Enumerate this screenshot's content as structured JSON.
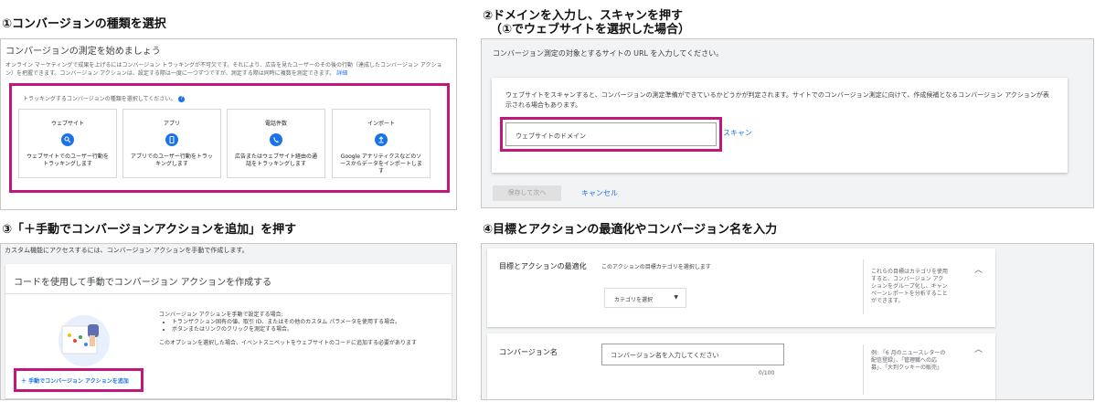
{
  "q1": {
    "title": "①コンバージョンの種類を選択",
    "panel_heading": "コンバージョンの測定を始めましょう",
    "description": "オンライン マーケティングで成果を上げるにはコンバージョン トラッキングが不可欠です。それにより、広告を見たユーザーのその後の行動（達成したコンバージョン アクション）を把握できます。コンバージョン アクションは、設定する際は一度に一つずつですが、測定する際は同時に複数を測定できます。",
    "description_link": "詳細",
    "prompt": "トラッキングするコンバージョンの種類を選択してください。",
    "cards": [
      {
        "title": "ウェブサイト",
        "icon": "cursor-click-icon",
        "desc": "ウェブサイトでのユーザー行動をトラッキングします"
      },
      {
        "title": "アプリ",
        "icon": "phone-app-icon",
        "desc": "アプリでのユーザー行動をトラッキングします"
      },
      {
        "title": "電話件数",
        "icon": "phone-call-icon",
        "desc": "広告またはウェブサイト経由の通話をトラッキングします"
      },
      {
        "title": "インポート",
        "icon": "upload-icon",
        "desc": "Google アナリティクスなどのソースからデータをインポートします"
      }
    ]
  },
  "q2": {
    "title_line1": "②ドメインを入力し、スキャンを押す",
    "title_line2": "（①でウェブサイトを選択した場合）",
    "heading": "コンバージョン測定の対象とするサイトの URL を入力してください。",
    "description": "ウェブサイトをスキャンすると、コンバージョンの測定準備ができているかどうかが判定されます。サイトでのコンバージョン測定に向けて、作成候補となるコンバージョン アクションが表示される場合もあります。",
    "input_placeholder": "ウェブサイトのドメイン",
    "scan_label": "スキャン",
    "save_label": "保存して次へ",
    "cancel_label": "キャンセル"
  },
  "q3": {
    "title": "③「＋手動でコンバージョンアクションを追加」を押す",
    "heading": "カスタム機能にアクセスするには、コンバージョン アクションを手動で作成します。",
    "card_title": "コードを使用して手動でコンバージョン アクションを作成する",
    "text_intro": "コンバージョン アクションを手動で設定する場合:",
    "bullets": [
      "トランザクション固有の値、取引 ID、またはその他のカスタム パラメータを使用する場合。",
      "ボタンまたはリンクのクリックを測定する場合。"
    ],
    "text_note": "このオプションを選択した場合、イベントスニペットをウェブサイトのコードに追加する必要があります",
    "add_label": "＋ 手動でコンバージョン アクションを追加"
  },
  "q4": {
    "title": "④目標とアクションの最適化やコンバージョン名を入力",
    "goal_label": "目標とアクションの最適化",
    "goal_sub": "このアクションの目標カテゴリを選択します",
    "category_select": "カテゴリを選択",
    "goal_help": "これらの目標はカテゴリを使用すると、コンバージョン アクションをグループ化し、キャンペーンレポートを分析することができます。",
    "name_label": "コンバージョン名",
    "name_placeholder": "コンバージョン名を入力してください",
    "name_count": "0/100",
    "name_help": "例: 「6 月のニュースレターの配信登録」、「管理職への応募」、「大判クッキーの販売」"
  }
}
